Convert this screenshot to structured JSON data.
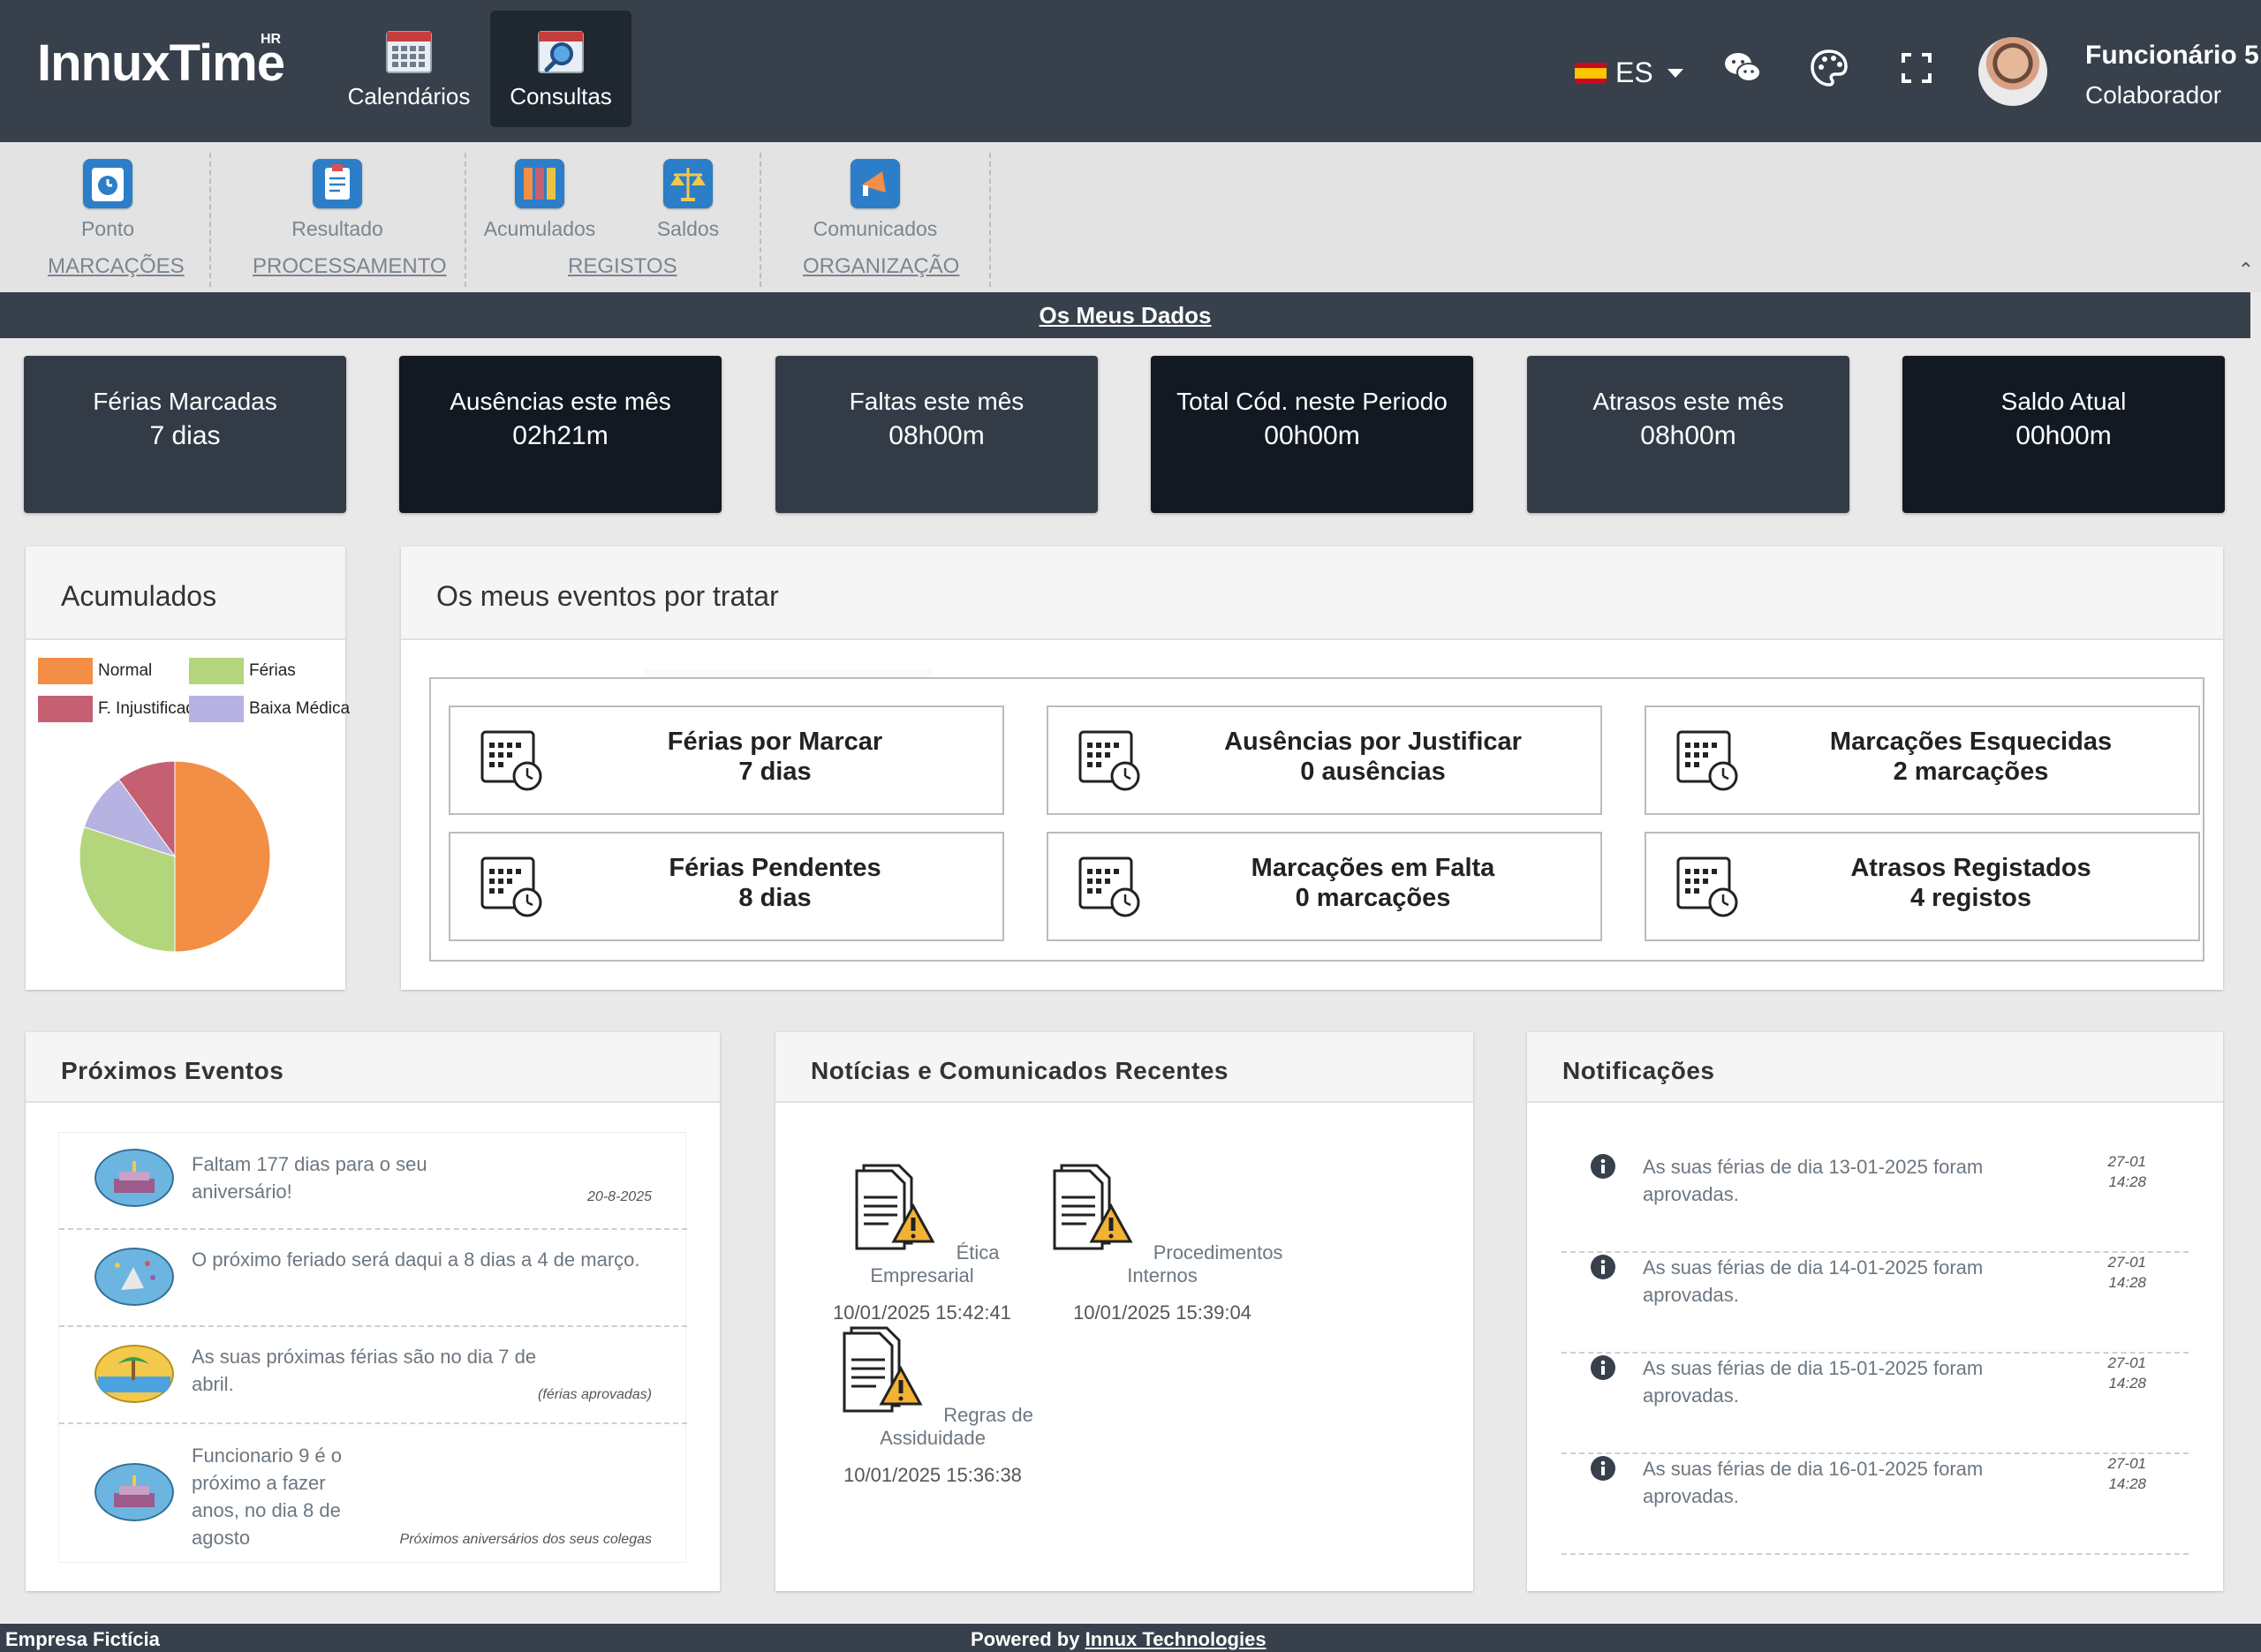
{
  "app": {
    "logo": "InnuxTime",
    "logo_sup": "HR"
  },
  "nav": [
    {
      "label": "Calendários",
      "icon": "calendar-icon",
      "active": false
    },
    {
      "label": "Consultas",
      "icon": "search-calendar-icon",
      "active": true
    }
  ],
  "header": {
    "language": "ES",
    "user_name": "Funcionário 5",
    "user_role": "Colaborador"
  },
  "ribbon": {
    "items": [
      {
        "label": "Ponto",
        "icon": "clock-icon"
      },
      {
        "label": "Resultado",
        "icon": "clipboard-icon"
      },
      {
        "label": "Acumulados",
        "icon": "binders-icon"
      },
      {
        "label": "Saldos",
        "icon": "scales-icon"
      },
      {
        "label": "Comunicados",
        "icon": "megaphone-icon"
      }
    ],
    "groups": [
      "MARCAÇÕES",
      "PROCESSAMENTO",
      "REGISTOS",
      "ORGANIZAÇÃO"
    ]
  },
  "section_title": "Os Meus Dados",
  "stats": [
    {
      "title": "Férias Marcadas",
      "value": "7 dias"
    },
    {
      "title": "Ausências este mês",
      "value": "02h21m"
    },
    {
      "title": "Faltas este mês",
      "value": "08h00m"
    },
    {
      "title": "Total Cód. neste Periodo",
      "value": "00h00m"
    },
    {
      "title": "Atrasos este mês",
      "value": "08h00m"
    },
    {
      "title": "Saldo Atual",
      "value": "00h00m"
    }
  ],
  "acumulados": {
    "title": "Acumulados",
    "legend": [
      {
        "label": "Normal",
        "color": "#f28e45"
      },
      {
        "label": "Férias",
        "color": "#b3d67d"
      },
      {
        "label": "F. Injustificada",
        "color": "#c55f72"
      },
      {
        "label": "Baixa Médica",
        "color": "#b6b2e2"
      }
    ]
  },
  "chart_data": {
    "type": "pie",
    "categories": [
      "Normal",
      "Férias",
      "Baixa Médica",
      "F. Injustificada"
    ],
    "values": [
      50,
      30,
      10,
      10
    ],
    "colors": [
      "#f28e45",
      "#b3d67d",
      "#b6b2e2",
      "#c55f72"
    ]
  },
  "events": {
    "title": "Os meus eventos por tratar",
    "items": [
      {
        "title": "Férias por Marcar",
        "value": "7 dias"
      },
      {
        "title": "Ausências por Justificar",
        "value": "0 ausências"
      },
      {
        "title": "Marcações Esquecidas",
        "value": "2 marcações"
      },
      {
        "title": "Férias Pendentes",
        "value": "8 dias"
      },
      {
        "title": "Marcações em Falta",
        "value": "0 marcações"
      },
      {
        "title": "Atrasos Registados",
        "value": "4 registos"
      }
    ]
  },
  "proximos": {
    "title": "Próximos Eventos",
    "items": [
      {
        "text": "Faltam 177 dias para o seu aniversário!",
        "meta": "20-8-2025",
        "icon": "birthday-cake-icon"
      },
      {
        "text": "O próximo feriado será daqui a 8 dias a 4 de março.",
        "meta": "",
        "icon": "party-icon"
      },
      {
        "text": "As suas próximas férias são no dia 7 de abril.",
        "meta": "(férias aprovadas)",
        "icon": "beach-icon"
      },
      {
        "text": "Funcionario 9 é o próximo a fazer anos, no dia 8 de agosto",
        "meta": "Próximos aniversários dos seus colegas",
        "icon": "birthday-cake-icon"
      }
    ]
  },
  "noticias": {
    "title": "Notícias e Comunicados Recentes",
    "items": [
      {
        "title": "Ética Empresarial",
        "date": "10/01/2025 15:42:41"
      },
      {
        "title": "Procedimentos Internos",
        "date": "10/01/2025 15:39:04"
      },
      {
        "title": "Regras de Assiduidade",
        "date": "10/01/2025 15:36:38"
      }
    ]
  },
  "notificacoes": {
    "title": "Notificações",
    "items": [
      {
        "text": "As suas férias de dia 13-01-2025 foram aprovadas.",
        "date": "27-01",
        "time": "14:28"
      },
      {
        "text": "As suas férias de dia 14-01-2025 foram aprovadas.",
        "date": "27-01",
        "time": "14:28"
      },
      {
        "text": "As suas férias de dia 15-01-2025 foram aprovadas.",
        "date": "27-01",
        "time": "14:28"
      },
      {
        "text": "As suas férias de dia 16-01-2025 foram aprovadas.",
        "date": "27-01",
        "time": "14:28"
      }
    ]
  },
  "footer": {
    "company": "Empresa Fictícia",
    "powered_prefix": "Powered by",
    "powered_link": "Innux Technologies"
  }
}
